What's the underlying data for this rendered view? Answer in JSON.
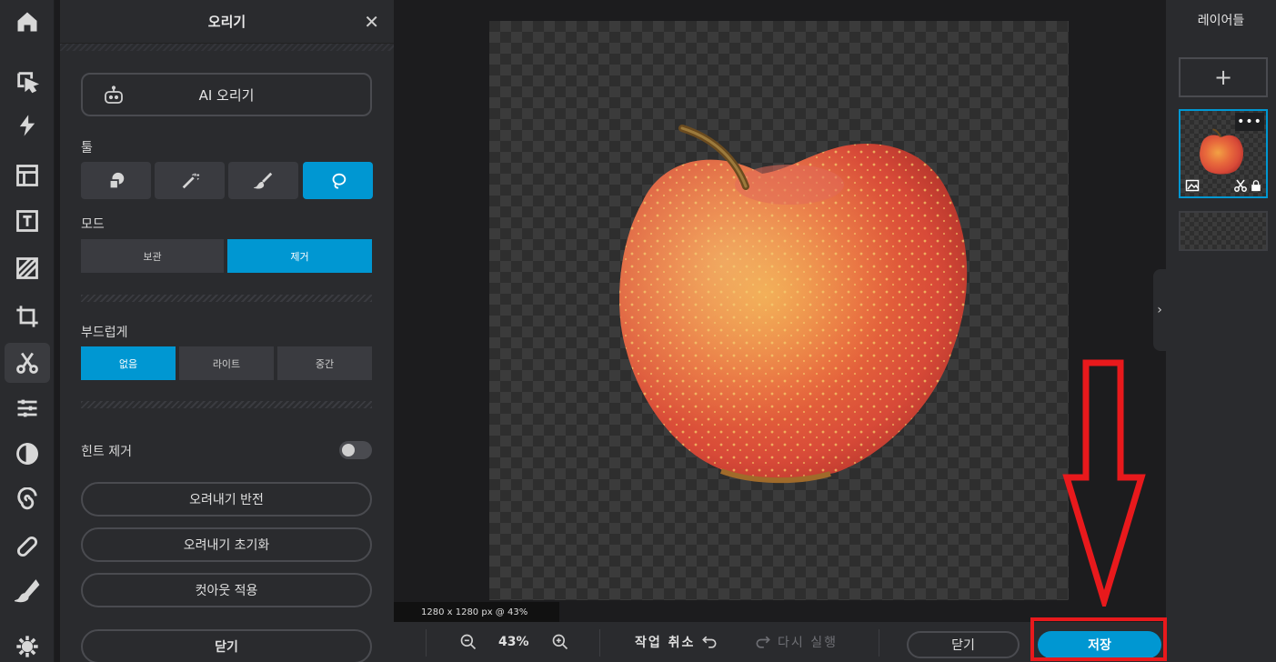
{
  "rail": {
    "items": [
      "home-icon",
      "select-icon",
      "lightning-icon",
      "layout-icon",
      "text-icon",
      "texture-icon",
      "crop-icon",
      "scissors-icon",
      "adjust-icon",
      "contrast-icon",
      "swirl-icon",
      "bandage-icon",
      "brush-icon",
      "settings-icon"
    ]
  },
  "panel": {
    "title": "오리기",
    "close": "✕",
    "ai_button": "AI 오리기",
    "tools_label": "툴",
    "mode_label": "모드",
    "mode_keep": "보관",
    "mode_remove": "제거",
    "soft_label": "부드럽게",
    "soft_none": "없음",
    "soft_light": "라이트",
    "soft_medium": "중간",
    "hint_remove": "힌트 제거",
    "invert": "오려내기 반전",
    "reset": "오려내기 초기화",
    "apply": "컷아웃 적용",
    "close_btn": "닫기"
  },
  "canvas": {
    "dimensions": "1280 x 1280 px @ 43%"
  },
  "bottom": {
    "zoom": "43%",
    "undo": "작업 취소",
    "redo": "다시 실행",
    "close": "닫기",
    "save": "저장"
  },
  "layers": {
    "title": "레이어들",
    "add": "+",
    "more": "•••"
  },
  "colors": {
    "accent": "#0097d2",
    "annotation": "#e8191c"
  }
}
